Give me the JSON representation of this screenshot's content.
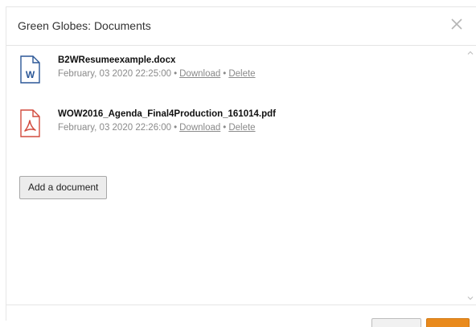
{
  "modal": {
    "title": "Green Globes: Documents",
    "close_icon": "close-icon"
  },
  "documents": [
    {
      "name": "B2WResumeexample.docx",
      "date": "February, 03 2020 22:25:00",
      "download_label": "Download",
      "delete_label": "Delete",
      "icon": "word-document-icon",
      "icon_color": "#2b5797"
    },
    {
      "name": "WOW2016_Agenda_Final4Production_161014.pdf",
      "date": "February, 03 2020 22:26:00",
      "download_label": "Download",
      "delete_label": "Delete",
      "icon": "pdf-document-icon",
      "icon_color": "#d24c3f"
    }
  ],
  "separator": "•",
  "add_button": {
    "label": "Add a document"
  },
  "colors": {
    "accent": "#e98a1d",
    "meta_text": "#8a8a8a"
  }
}
